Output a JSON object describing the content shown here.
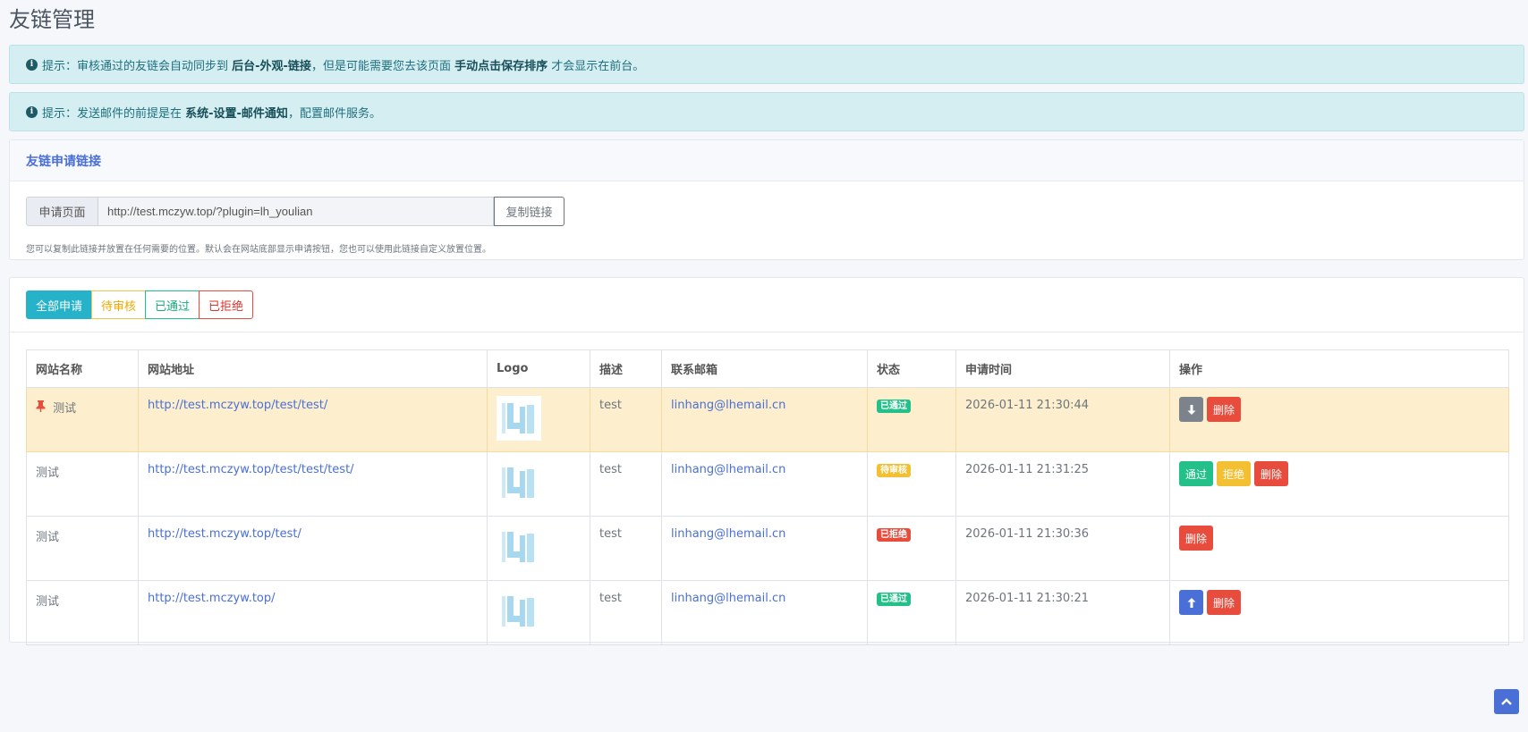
{
  "page": {
    "title": "友链管理"
  },
  "alerts": [
    {
      "prefix": "提示：审核通过的友链会自动同步到 ",
      "bold1": "后台-外观-链接",
      "mid": "，但是可能需要您去该页面 ",
      "bold2": "手动点击保存排序",
      "suffix": " 才会显示在前台。"
    },
    {
      "prefix": "提示：发送邮件的前提是在 ",
      "bold1": "系统-设置-邮件通知",
      "suffix": "，配置邮件服务。"
    }
  ],
  "apply_link": {
    "header": "友链申请链接",
    "prefix_label": "申请页面",
    "url": "http://test.mczyw.top/?plugin=lh_youlian",
    "copy_button": "复制链接",
    "help": "您可以复制此链接并放置在任何需要的位置。默认会在网站底部显示申请按钮，您也可以使用此链接自定义放置位置。"
  },
  "filters": {
    "all": "全部申请",
    "pending": "待审核",
    "passed": "已通过",
    "rejected": "已拒绝"
  },
  "table": {
    "headers": {
      "name": "网站名称",
      "url": "网站地址",
      "logo": "Logo",
      "desc": "描述",
      "email": "联系邮箱",
      "status": "状态",
      "time": "申请时间",
      "actions": "操作"
    },
    "rows": [
      {
        "name": "测试",
        "url": "http://test.mczyw.top/test/test/",
        "desc": "test",
        "email": "linhang@lhemail.cn",
        "status": "已通过",
        "time": "2026-01-11 21:30:44",
        "btn_delete": "删除"
      },
      {
        "name": "测试",
        "url": "http://test.mczyw.top/test/test/test/",
        "desc": "test",
        "email": "linhang@lhemail.cn",
        "status": "待审核",
        "time": "2026-01-11 21:31:25",
        "btn_approve": "通过",
        "btn_reject": "拒绝",
        "btn_delete": "删除"
      },
      {
        "name": "测试",
        "url": "http://test.mczyw.top/test/",
        "desc": "test",
        "email": "linhang@lhemail.cn",
        "status": "已拒绝",
        "time": "2026-01-11 21:30:36",
        "btn_delete": "删除"
      },
      {
        "name": "测试",
        "url": "http://test.mczyw.top/",
        "desc": "test",
        "email": "linhang@lhemail.cn",
        "status": "已通过",
        "time": "2026-01-11 21:30:21",
        "btn_delete": "删除"
      }
    ]
  },
  "icons": {
    "info": "info-circle-icon",
    "pin": "thumbtack-icon",
    "down": "arrow-down-icon",
    "up": "arrow-up-icon",
    "scroll_top": "chevron-up-icon"
  },
  "colors": {
    "accent": "#4a6fd6",
    "info_bg": "#d5eef2",
    "success": "#23c08a",
    "warning": "#f3c034",
    "danger": "#e74c3c",
    "pinned_row": "#fdefcd"
  }
}
